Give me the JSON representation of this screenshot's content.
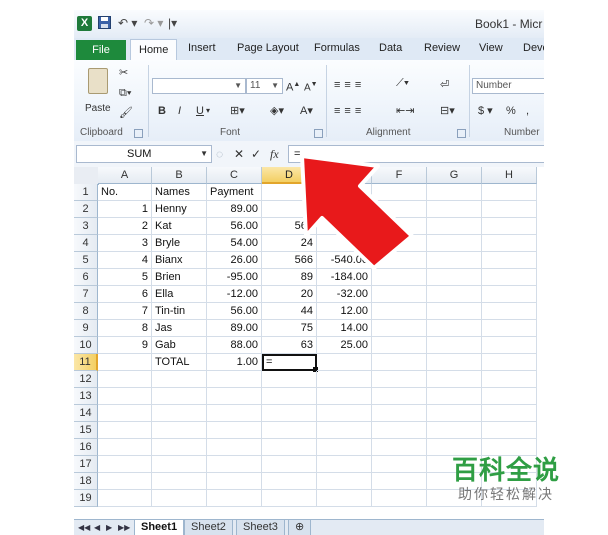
{
  "title_bar": {
    "title": "Book1 - Micr",
    "undo": "↶ ▾",
    "redo": "↷ ▾"
  },
  "ribbon_tabs": [
    "File",
    "Home",
    "Insert",
    "Page Layout",
    "Formulas",
    "Data",
    "Review",
    "View",
    "Deve"
  ],
  "active_tab": "Home",
  "ribbon": {
    "paste_label": "Paste",
    "font_size": "11",
    "number_format": "Number",
    "bold": "B",
    "italic": "I",
    "underline": "U",
    "font_color_glyph": "A",
    "currency": "$",
    "percent": "%",
    "groups": {
      "clipboard": "Clipboard",
      "font": "Font",
      "alignment": "Alignment",
      "number": "Number"
    }
  },
  "formula_bar": {
    "name_box": "SUM",
    "cancel": "✕",
    "enter": "✓",
    "fx": "fx",
    "content": "="
  },
  "columns": [
    "A",
    "B",
    "C",
    "D",
    "E",
    "F",
    "G",
    "H"
  ],
  "selected_column": "D",
  "selected_row": "11",
  "rows": [
    "1",
    "2",
    "3",
    "4",
    "5",
    "6",
    "7",
    "8",
    "9",
    "10",
    "11",
    "12",
    "13",
    "14",
    "15",
    "16",
    "17",
    "18",
    "19"
  ],
  "cells": {
    "A1": "No.",
    "B1": "Names",
    "C1": "Payment",
    "A2": "1",
    "B2": "Henny",
    "C2": "89.00",
    "D2": "9",
    "A3": "2",
    "B3": "Kat",
    "C3": "56.00",
    "D3": "562",
    "E3": "-5",
    "A4": "3",
    "B4": "Bryle",
    "C4": "54.00",
    "D4": "24",
    "E4": "30.",
    "A5": "4",
    "B5": "Bianx",
    "C5": "26.00",
    "D5": "566",
    "E5": "-540.00",
    "A6": "5",
    "B6": "Brien",
    "C6": "-95.00",
    "D6": "89",
    "E6": "-184.00",
    "A7": "6",
    "B7": "Ella",
    "C7": "-12.00",
    "D7": "20",
    "E7": "-32.00",
    "A8": "7",
    "B8": "Tin-tin",
    "C8": "56.00",
    "D8": "44",
    "E8": "12.00",
    "A9": "8",
    "B9": "Jas",
    "C9": "89.00",
    "D9": "75",
    "E9": "14.00",
    "A10": "9",
    "B10": "Gab",
    "C10": "88.00",
    "D10": "63",
    "E10": "25.00",
    "B11": "TOTAL",
    "C11": "1.00",
    "D11": "="
  },
  "sheet_tabs": [
    "Sheet1",
    "Sheet2",
    "Sheet3"
  ],
  "active_sheet": "Sheet1",
  "nav_glyphs": [
    "◀◀",
    "◀",
    "▶",
    "▶▶"
  ],
  "watermark": {
    "line1": "百科全说",
    "line2": "助你轻松解决"
  },
  "colors": {
    "file_tab": "#1e8a3c",
    "selection_header": "#f3cf63",
    "arrow": "#e8191b",
    "watermark": "#2f9e44"
  }
}
